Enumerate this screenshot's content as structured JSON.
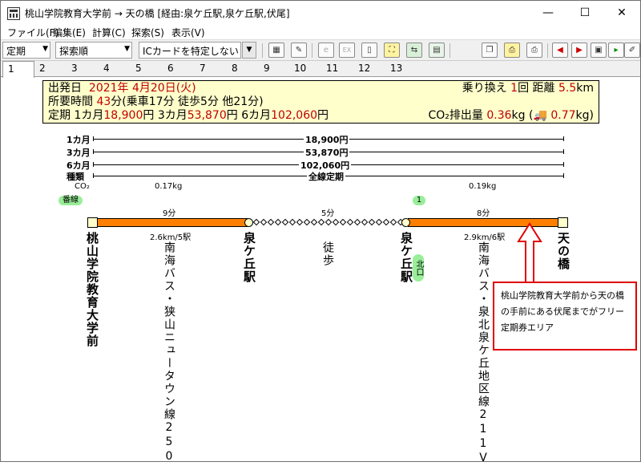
{
  "window": {
    "title": "桃山学院教育大学前 → 天の橋 [経由:泉ケ丘駅,泉ケ丘駅,伏尾]",
    "minimize": "—",
    "maximize": "☐",
    "close": "✕"
  },
  "menu": [
    "ファイル(F)",
    "編集(E)",
    "計算(C)",
    "探索(S)",
    "表示(V)"
  ],
  "toolbar": {
    "combo1": "定期",
    "combo2": "探索順",
    "combo3": "ICカードを特定しない",
    "combo_arrow": "▼",
    "icons": [
      {
        "name": "calendar-icon",
        "glyph": "▦"
      },
      {
        "name": "memo-icon",
        "glyph": "✎"
      },
      {
        "name": "e-icon",
        "glyph": "e"
      },
      {
        "name": "ex-icon",
        "glyph": "EX"
      },
      {
        "name": "ic-icon",
        "glyph": "▯"
      },
      {
        "name": "map-icon",
        "glyph": "⛶"
      },
      {
        "name": "route-icon",
        "glyph": "⇆"
      },
      {
        "name": "export-icon",
        "glyph": "▤"
      },
      {
        "name": "copy-icon",
        "glyph": "❐"
      },
      {
        "name": "print-icon",
        "glyph": "⎙"
      },
      {
        "name": "time-prev-icon",
        "glyph": "◀"
      },
      {
        "name": "time-next-icon",
        "glyph": "▶"
      },
      {
        "name": "timetable-icon",
        "glyph": "▣"
      },
      {
        "name": "play-icon",
        "glyph": "▸"
      },
      {
        "name": "edit-icon",
        "glyph": "✐"
      }
    ]
  },
  "tabs": [
    "1",
    "2",
    "3",
    "4",
    "5",
    "6",
    "7",
    "8",
    "9",
    "10",
    "11",
    "12",
    "13"
  ],
  "summary": {
    "date_label": "出発日",
    "date_value": "2021年 4月20日(火)",
    "transfer_label": "乗り換え",
    "transfer_value": "1",
    "transfer_unit": "回",
    "distance_label": "距離",
    "distance_value": "5.5",
    "distance_unit": "km",
    "time_label": "所要時間",
    "time_value": "43",
    "time_detail": "分(乗車17分 徒歩5分 他21分)",
    "pass_label": "定期",
    "pass_1m_label": "1カ月",
    "pass_1m": "18,900",
    "pass_3m_label": "3カ月",
    "pass_3m": "53,870",
    "pass_6m_label": "6カ月",
    "pass_6m": "102,060",
    "yen": "円",
    "co2_label": "CO₂排出量",
    "co2_value": "0.36",
    "kg": "kg",
    "co2_car_open": "(",
    "car_glyph": "🚚",
    "co2_car_value": "0.77",
    "co2_car_close": "kg)"
  },
  "fares": [
    {
      "label": "1カ月",
      "value": "18,900円"
    },
    {
      "label": "3カ月",
      "value": "53,870円"
    },
    {
      "label": "6カ月",
      "value": "102,060円"
    },
    {
      "label": "種類",
      "value": "全線定期"
    }
  ],
  "co2": {
    "label": "CO₂",
    "seg1": "0.17kg",
    "seg2": "0.19kg"
  },
  "badges": {
    "line_no": "番線",
    "platform": "1",
    "exit": "北口"
  },
  "segments": [
    {
      "time": "9分",
      "dist": "2.6km/5駅",
      "line": "南海バス・狭山ニュータウン線250"
    },
    {
      "time": "5分",
      "line": "徒歩"
    },
    {
      "time": "8分",
      "dist": "2.9km/6駅",
      "line": "南海バス・泉北泉ケ丘地区線211V"
    }
  ],
  "stations": [
    "桃山学院教育大学前",
    "泉ケ丘駅",
    "泉ケ丘駅",
    "天の橋"
  ],
  "note": "桃山学院教育大学前から天の橋の手前にある伏尾までがフリー定期券エリア"
}
